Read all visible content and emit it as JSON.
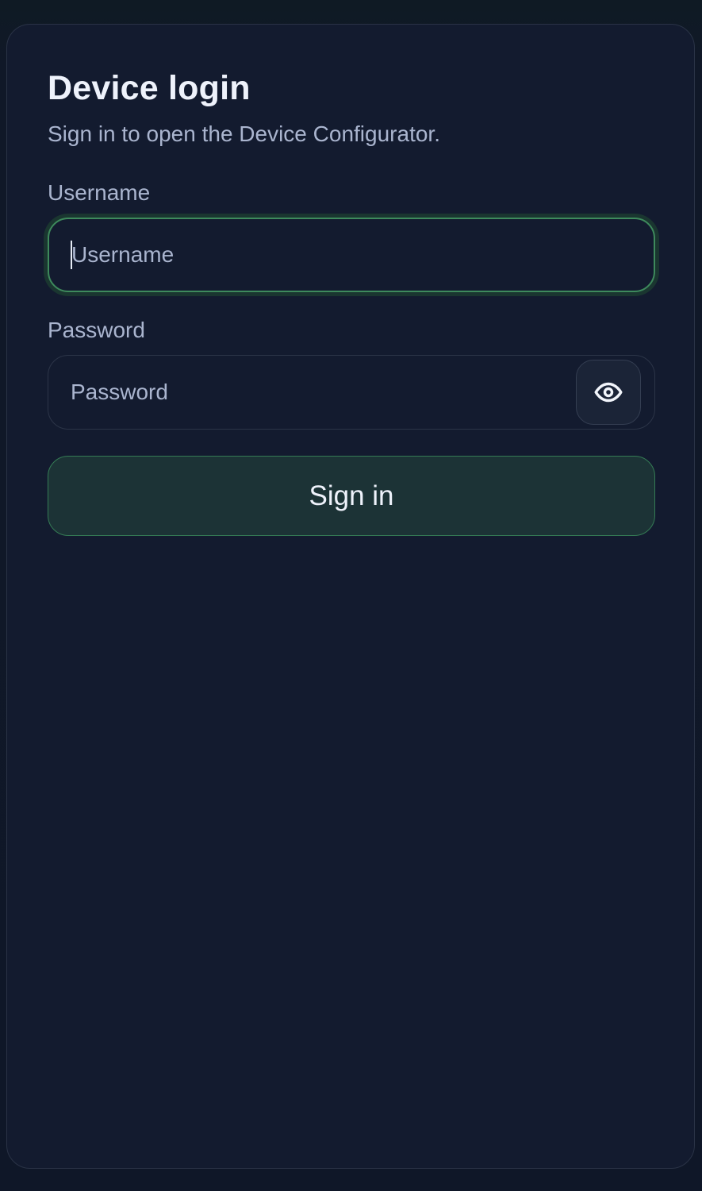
{
  "login": {
    "title": "Device login",
    "subtitle": "Sign in to open the Device Configurator.",
    "username": {
      "label": "Username",
      "placeholder": "Username",
      "value": ""
    },
    "password": {
      "label": "Password",
      "placeholder": "Password",
      "value": "",
      "toggle_icon": "eye-icon"
    },
    "submit_label": "Sign in"
  },
  "colors": {
    "background": "#131b2f",
    "accent": "#3e8a5c",
    "button_bg": "#1c3336",
    "text_primary": "#eef2fb",
    "text_secondary": "#aab5cf"
  }
}
